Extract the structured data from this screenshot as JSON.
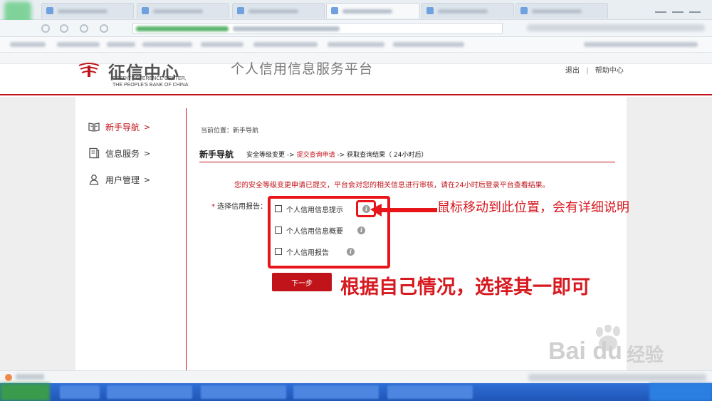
{
  "header": {
    "logo_title": "征信中心",
    "logo_sub_line1": "CREDIT REFERENCE CENTER,",
    "logo_sub_line2": "THE PEOPLE'S BANK OF CHINA",
    "platform_title": "个人信用信息服务平台",
    "link_logout": "退出",
    "link_separator": "|",
    "link_help": "帮助中心"
  },
  "sidebar": {
    "items": [
      {
        "label": "新手导航",
        "arrow": ">",
        "icon": "book-icon",
        "active": true
      },
      {
        "label": "信息服务",
        "arrow": ">",
        "icon": "document-icon",
        "active": false
      },
      {
        "label": "用户管理",
        "arrow": ">",
        "icon": "user-icon",
        "active": false
      }
    ]
  },
  "main": {
    "breadcrumb": "当前位置：新手导航",
    "step_title": "新手导航",
    "steps": {
      "step1": "安全等级变更",
      "arrow1": "->",
      "step2": "提交查询申请",
      "arrow2": "->",
      "step3": "获取查询结果（ 24小时后）"
    },
    "notice": "您的安全等级变更申请已提交，平台会对您的相关信息进行审核，请在24小时后登录平台查看结果。",
    "field_required_mark": "*",
    "field_label": "选择信用报告：",
    "options": [
      {
        "label": "个人信用信息提示",
        "checked": false
      },
      {
        "label": "个人信用信息概要",
        "checked": false
      },
      {
        "label": "个人信用报告",
        "checked": false
      }
    ],
    "info_glyph": "i",
    "next_button": "下一步"
  },
  "annotations": {
    "hover_hint": "鼠标移动到此位置，会有详细说明",
    "choose_hint": "根据自己情况，选择其一即可"
  },
  "watermark": {
    "latin": "Bai du",
    "cn": "经验"
  },
  "colors": {
    "brand_red": "#c0141a",
    "annotation_red": "#e8141a",
    "taskbar_blue": "#1f56b7"
  }
}
